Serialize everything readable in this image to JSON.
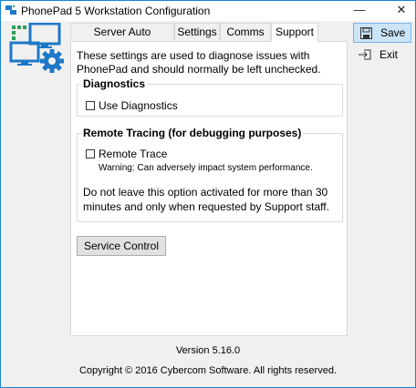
{
  "window": {
    "title": "PhonePad 5 Workstation Configuration",
    "minimize": "—",
    "close": "✕"
  },
  "tabs": [
    {
      "label": "Server Auto Discovery"
    },
    {
      "label": "Settings"
    },
    {
      "label": "Comms"
    },
    {
      "label": "Support",
      "active": true
    }
  ],
  "support": {
    "intro": "These settings are used to diagnose issues with PhonePad and should normally be left unchecked.",
    "diagnostics": {
      "legend": "Diagnostics",
      "checkbox_label": "Use Diagnostics",
      "checked": false
    },
    "tracing": {
      "legend": "Remote Tracing (for debugging purposes)",
      "checkbox_label": "Remote Trace",
      "checked": false,
      "warning": "Warning: Can adversely impact system performance.",
      "note": "Do not leave this option activated for more than 30 minutes and only when requested by Support staff."
    },
    "service_button": "Service Control"
  },
  "actions": {
    "save": "Save",
    "exit": "Exit"
  },
  "footer": {
    "version": "Version 5.16.0",
    "copyright": "Copyright © 2016 Cybercom Software. All rights reserved."
  },
  "colors": {
    "accent": "#1883d7",
    "save_bg": "#cce4f7",
    "logo_blue": "#1e78c8",
    "logo_green": "#2aa05a"
  }
}
